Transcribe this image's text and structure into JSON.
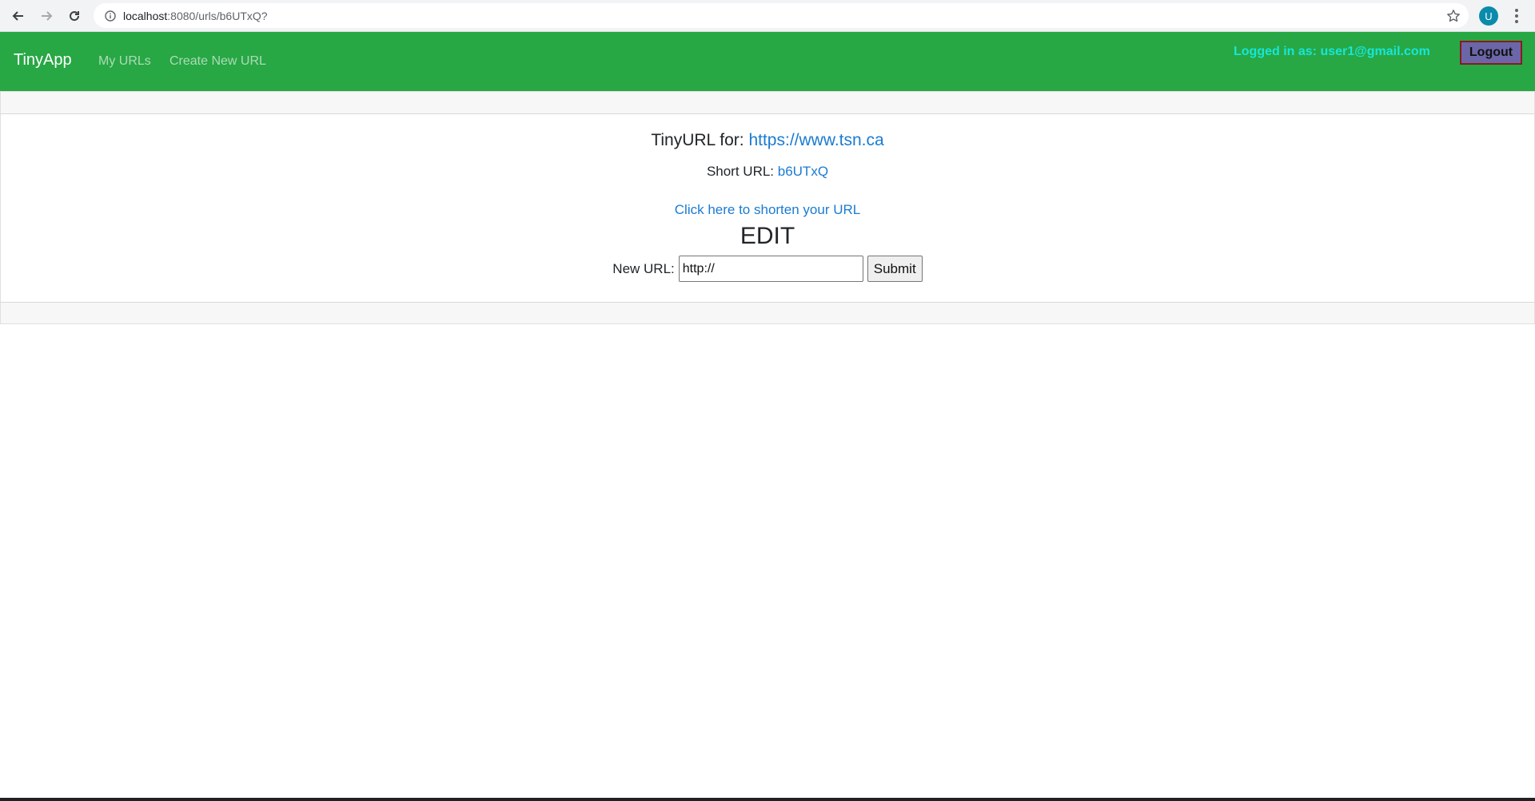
{
  "browser": {
    "url_host": "localhost",
    "url_rest": ":8080/urls/b6UTxQ?",
    "profile_initial": "U"
  },
  "navbar": {
    "brand": "TinyApp",
    "links": [
      "My URLs",
      "Create New URL"
    ],
    "logged_in_text": "Logged in as: user1@gmail.com",
    "logout_label": "Logout",
    "colors": {
      "background": "#28a745",
      "logged_in": "#17e6d8",
      "logout_bg": "#6b66a8"
    }
  },
  "main": {
    "tiny_prefix": "TinyURL for: ",
    "long_url": "https://www.tsn.ca",
    "short_prefix": "Short URL: ",
    "short_code": "b6UTxQ",
    "shorten_link": "Click here to shorten your URL",
    "edit_heading": "EDIT",
    "new_url_label": "New URL:",
    "new_url_value": "http://",
    "submit_label": "Submit"
  }
}
